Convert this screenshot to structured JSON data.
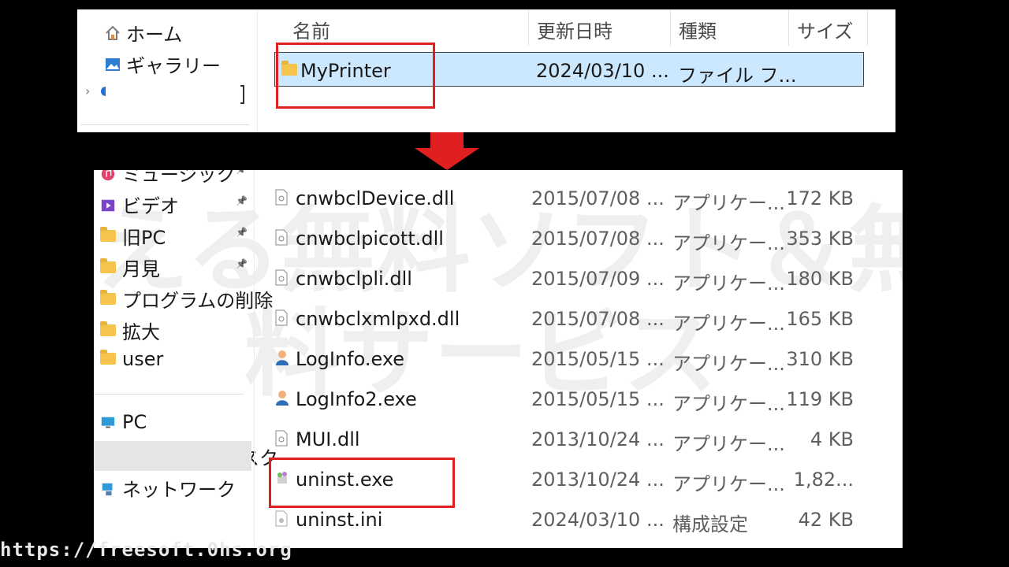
{
  "top": {
    "nav": [
      "ホーム",
      "ギャラリー"
    ],
    "headers": [
      "名前",
      "更新日時",
      "種類",
      "サイズ"
    ],
    "selected_row": {
      "name": "MyPrinter",
      "date": "2024/03/10 ...",
      "type": "ファイル フ..."
    }
  },
  "bottom": {
    "nav": [
      {
        "label": "ミュージック",
        "icon": "music-icon"
      },
      {
        "label": "ビデオ",
        "icon": "video-icon"
      },
      {
        "label": "旧PC",
        "icon": "folder-icon"
      },
      {
        "label": "月見",
        "icon": "folder-icon"
      },
      {
        "label": "プログラムの削除",
        "icon": "folder-icon"
      },
      {
        "label": "拡大",
        "icon": "folder-icon"
      },
      {
        "label": "user",
        "icon": "folder-icon"
      },
      {
        "label": "PC",
        "icon": "pc-icon"
      },
      {
        "label": "ローカル ディスク",
        "icon": "drive-icon"
      },
      {
        "label": "ネットワーク",
        "icon": "network-icon"
      }
    ],
    "files": [
      {
        "name": "cnwbclDevice.dll",
        "date": "2015/07/08 ...",
        "type": "アプリケー...",
        "size": "172 KB",
        "icon": "dll-icon"
      },
      {
        "name": "cnwbclpicott.dll",
        "date": "2015/07/08 ...",
        "type": "アプリケー...",
        "size": "353 KB",
        "icon": "dll-icon"
      },
      {
        "name": "cnwbclpli.dll",
        "date": "2015/07/09 ...",
        "type": "アプリケー...",
        "size": "180 KB",
        "icon": "dll-icon"
      },
      {
        "name": "cnwbclxmlpxd.dll",
        "date": "2015/07/08 ...",
        "type": "アプリケー...",
        "size": "165 KB",
        "icon": "dll-icon"
      },
      {
        "name": "LogInfo.exe",
        "date": "2015/05/15 ...",
        "type": "アプリケー...",
        "size": "310 KB",
        "icon": "user-exe-icon"
      },
      {
        "name": "LogInfo2.exe",
        "date": "2015/05/15 ...",
        "type": "アプリケー...",
        "size": "119 KB",
        "icon": "user-exe-icon"
      },
      {
        "name": "MUI.dll",
        "date": "2013/10/24 ...",
        "type": "アプリケー...",
        "size": "4 KB",
        "icon": "dll-icon"
      },
      {
        "name": "uninst.exe",
        "date": "2013/10/24 ...",
        "type": "アプリケー...",
        "size": "1,82...",
        "icon": "installer-icon"
      },
      {
        "name": "uninst.ini",
        "date": "2024/03/10 ...",
        "type": "構成設定",
        "size": "42 KB",
        "icon": "ini-icon"
      }
    ]
  },
  "watermark": {
    "line1": "使える無料ソフト＆無",
    "line2": "料サービス"
  },
  "url": "https://freesoft.0hs.org",
  "colors": {
    "highlight": "#cce8ff",
    "annotation": "#e02020",
    "folder": "#f6c44c"
  }
}
